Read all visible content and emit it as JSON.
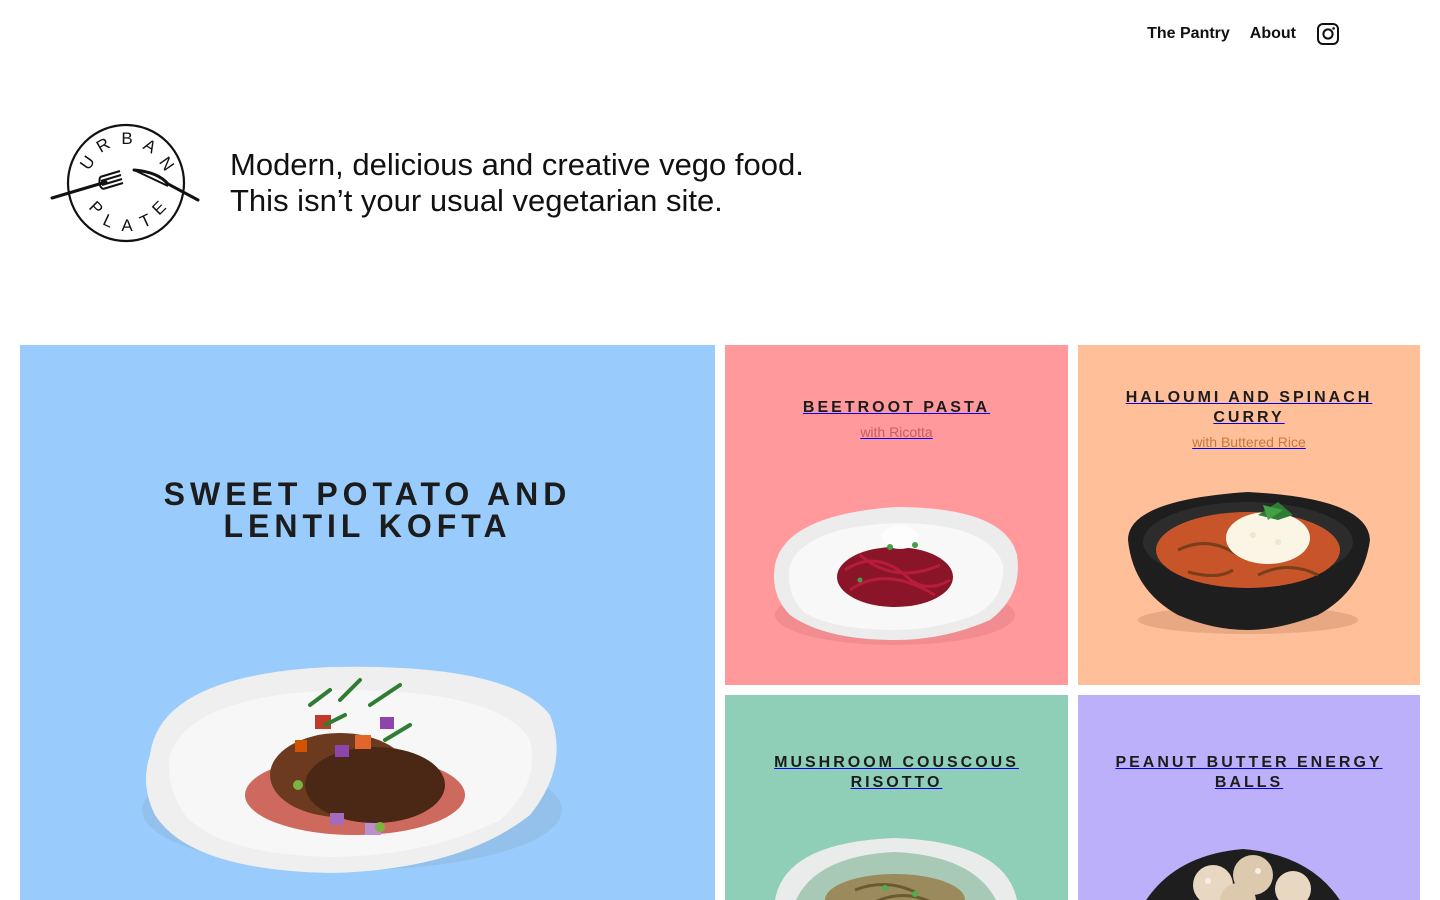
{
  "nav": {
    "pantry_label": "The Pantry",
    "about_label": "About"
  },
  "brand": {
    "logo_text": "URBAN PLATE",
    "tagline_line1": "Modern, delicious and creative vego food.",
    "tagline_line2": "This isn’t your usual vegetarian site."
  },
  "tiles": [
    {
      "title": "Sweet Potato and Lentil Kofta",
      "subtitle": "",
      "bg": "#99ccfc"
    },
    {
      "title": "Beetroot Pasta",
      "subtitle": "with Ricotta",
      "bg": "#ff999c",
      "sub_color": "#c75d66"
    },
    {
      "title": "Haloumi and Spinach Curry",
      "subtitle": "with Buttered Rice",
      "bg": "#ffbf99",
      "sub_color": "#c7773d"
    },
    {
      "title": "Mushroom Couscous Risotto",
      "subtitle": "",
      "bg": "#8fcfb8"
    },
    {
      "title": "Peanut Butter Energy Balls",
      "subtitle": "",
      "bg": "#bcb0fb"
    }
  ],
  "icons": {
    "instagram": "instagram-icon",
    "logo": "urban-plate-logo"
  }
}
